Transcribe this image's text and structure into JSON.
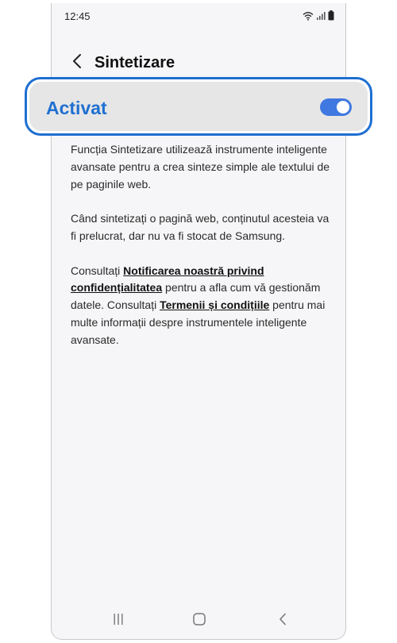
{
  "status_bar": {
    "time": "12:45",
    "icons": [
      "wifi-icon",
      "signal-icon",
      "battery-icon"
    ]
  },
  "header": {
    "back_icon": "chevron-left-icon",
    "title": "Sintetizare"
  },
  "toggle": {
    "label": "Activat",
    "checked": true,
    "accent_color": "#1f6fd1",
    "switch_color": "#3e78e0"
  },
  "description": {
    "p1": "Funcția Sintetizare utilizează instrumente inteligente avansate pentru a crea sinteze simple ale textului de pe paginile web.",
    "p2": "Când sintetizați o pagină web, conținutul acesteia va fi prelucrat, dar nu va fi stocat de Samsung.",
    "p3_part1": "Consultați ",
    "p3_link1": "Notificarea noastră privind confidențialitatea",
    "p3_part2": " pentru a afla cum vă gestionăm datele. Consultați ",
    "p3_link2": "Termenii și condițiile",
    "p3_part3": " pentru mai multe informații despre instrumentele inteligente avansate."
  },
  "nav_bar": {
    "icons": [
      "recent-apps-icon",
      "home-icon",
      "back-icon"
    ]
  }
}
